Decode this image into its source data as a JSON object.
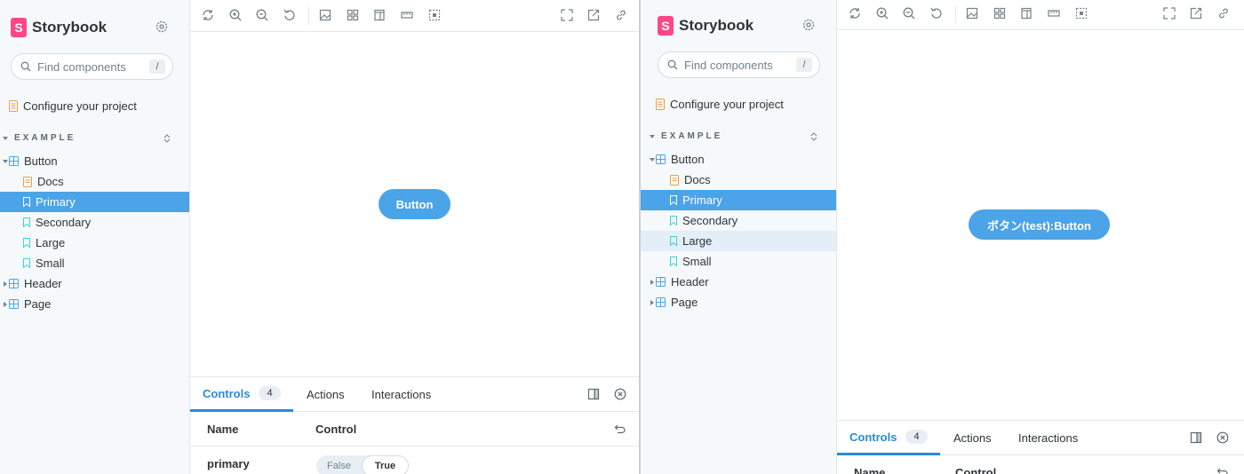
{
  "brand": {
    "logo_letter": "S",
    "name": "Storybook"
  },
  "sidebar": {
    "search_placeholder": "Find components",
    "search_shortcut": "/",
    "configure_label": "Configure your project",
    "group_label": "EXAMPLE",
    "items": [
      {
        "label": "Button",
        "type": "component"
      },
      {
        "label": "Docs",
        "type": "docs"
      },
      {
        "label": "Primary",
        "type": "story"
      },
      {
        "label": "Secondary",
        "type": "story"
      },
      {
        "label": "Large",
        "type": "story"
      },
      {
        "label": "Small",
        "type": "story"
      },
      {
        "label": "Header",
        "type": "component"
      },
      {
        "label": "Page",
        "type": "component"
      }
    ]
  },
  "left_preview": {
    "button_label": "Button"
  },
  "right_preview": {
    "button_label": "ボタン(test):Button"
  },
  "addons": {
    "tabs": [
      {
        "label": "Controls",
        "count": "4"
      },
      {
        "label": "Actions"
      },
      {
        "label": "Interactions"
      }
    ],
    "columns": {
      "name": "Name",
      "control": "Control"
    },
    "rows": [
      {
        "name": "primary",
        "toggle_false": "False",
        "toggle_true": "True"
      }
    ]
  },
  "colors": {
    "accent": "#4ba3e8",
    "brand": "#ff4785",
    "tab_active": "#2b8ad6"
  }
}
